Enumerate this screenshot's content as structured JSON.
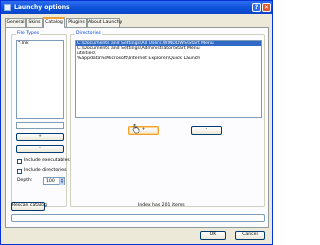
{
  "window": {
    "title": "Launchy options",
    "help_glyph": "?",
    "close_glyph": "✕"
  },
  "tabs": [
    {
      "label": "General"
    },
    {
      "label": "Skins"
    },
    {
      "label": "Catalog"
    },
    {
      "label": "Plugins"
    },
    {
      "label": "About Launchy"
    }
  ],
  "catalog": {
    "file_types_title": "File Types",
    "file_types": [
      "*.lnk"
    ],
    "file_type_input": "",
    "add_button": "+",
    "remove_button": "-",
    "include_executables_label": "Include executables",
    "include_executables_checked": false,
    "include_directories_label": "Include directories",
    "include_directories_checked": false,
    "depth_label": "Depth:",
    "depth_value": "100",
    "directories_title": "Directories",
    "directories": [
      "C:\\Documents and Settings\\All Users.WINDOWS\\Start Menu",
      "C:\\Documents and Settings\\Administrator\\Start Menu",
      "utilities\\",
      "%appdata%\\Microsoft\\Internet Explorer\\Quick Launch"
    ],
    "dir_add_button": "+",
    "dir_remove_button": "-",
    "rescan_button": "Rescan catalog",
    "index_status": "Index has 201 items"
  },
  "footer": {
    "ok_button": "OK",
    "cancel_button": "Cancel"
  }
}
